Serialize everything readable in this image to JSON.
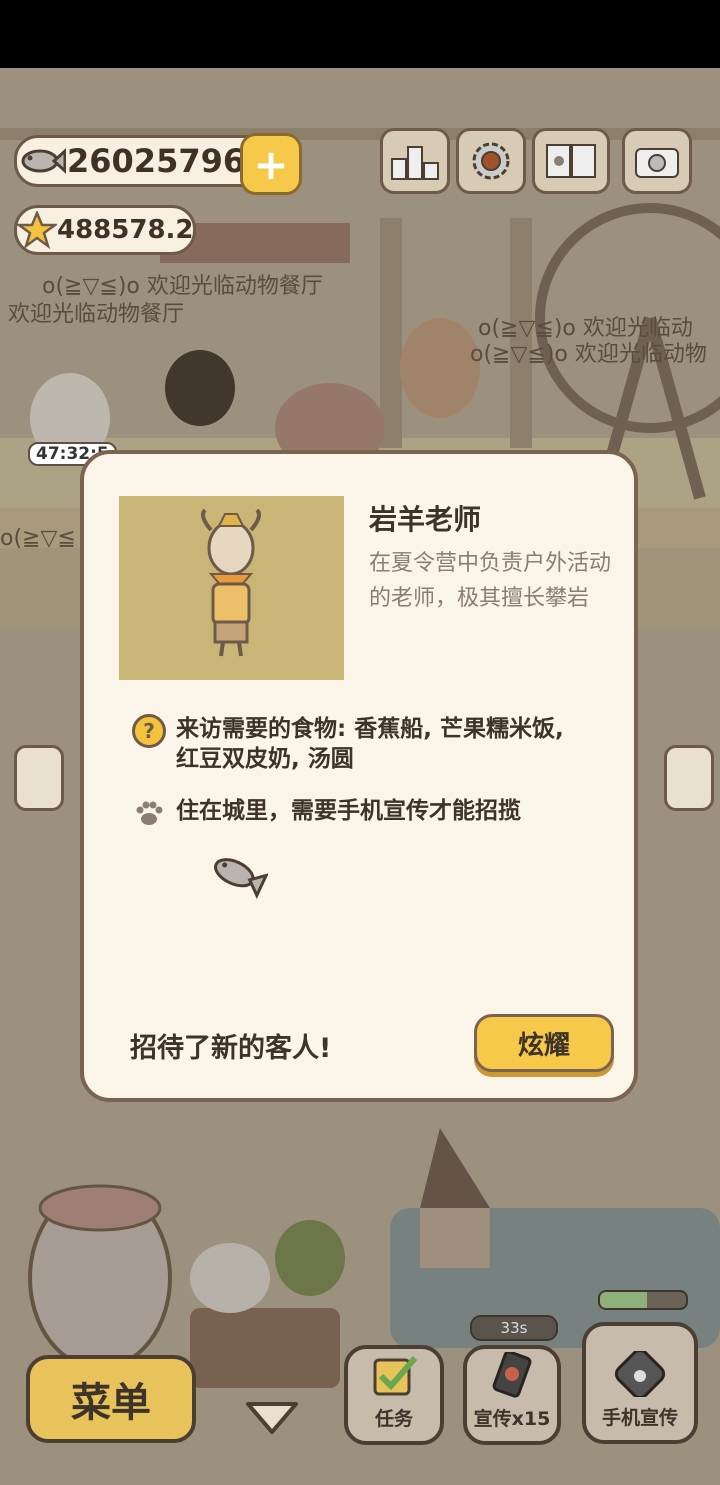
{
  "hud": {
    "fish_count": "26025796",
    "star_count": "488578.2",
    "timer": "47:32:5"
  },
  "scrolling_banners": [
    "o(≧▽≦)o 欢迎光临动物餐厅",
    "欢迎光临动物餐厅",
    "o(≧▽≦)o 欢迎光临动",
    "o(≧▽≦)o 欢迎光临动物",
    "o(≧▽≦"
  ],
  "modal": {
    "name": "岩羊老师",
    "description": "在夏令营中负责户外活动的老师，极其擅长攀岩",
    "food_label": "来访需要的食物: 香蕉船, 芒果糯米饭, 红豆双皮奶, 汤圆",
    "condition": "住在城里，需要手机宣传才能招揽",
    "footer_message": "招待了新的客人!",
    "show_button": "炫耀"
  },
  "bottom": {
    "menu": "菜单",
    "task": "任务",
    "promo": "宣传x15",
    "phone_promo": "手机宣传",
    "progress_label": "33s",
    "top_progress": 0.55
  },
  "colors": {
    "accent_yellow": "#f6c94a",
    "dialog_bg": "#fbf4e8",
    "outline": "#7a6351"
  }
}
